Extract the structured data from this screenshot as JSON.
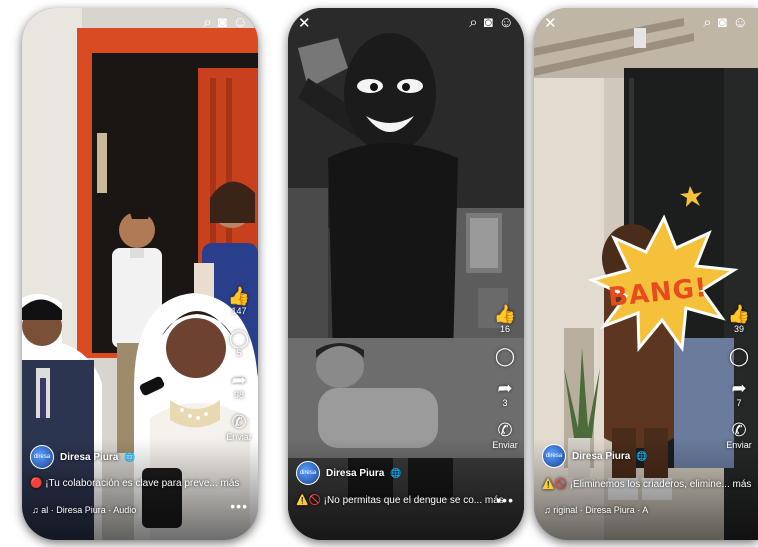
{
  "reels": [
    {
      "author": "Diresa Piura",
      "avatar_text": "diresa",
      "caption": "🔴 ¡Tu colaboración es clave para preve... más",
      "audio": "♫  al · Diresa Piura · Audio",
      "actions": [
        {
          "icon": "like-icon",
          "count": "147"
        },
        {
          "icon": "comment-icon",
          "count": "5"
        },
        {
          "icon": "share-icon",
          "count": "98"
        },
        {
          "icon": "whatsapp-icon",
          "count": "Enviar"
        }
      ]
    },
    {
      "author": "Diresa Piura",
      "avatar_text": "diresa",
      "caption": "⚠️🚫 ¡No permitas que el dengue se co... más",
      "actions": [
        {
          "icon": "like-icon",
          "count": "16"
        },
        {
          "icon": "comment-icon",
          "count": ""
        },
        {
          "icon": "share-icon",
          "count": "3"
        },
        {
          "icon": "whatsapp-icon",
          "count": "Enviar"
        }
      ]
    },
    {
      "author": "Diresa Piura",
      "avatar_text": "diresa",
      "caption": "⚠️🚫 ¡Eliminemos los criaderos, elimine... más",
      "audio": "♫  riginal · Diresa Piura · A",
      "bang_text": "BANG!",
      "actions": [
        {
          "icon": "like-icon",
          "count": "39"
        },
        {
          "icon": "comment-icon",
          "count": ""
        },
        {
          "icon": "share-icon",
          "count": "7"
        },
        {
          "icon": "whatsapp-icon",
          "count": "Enviar"
        }
      ]
    }
  ],
  "icons": {
    "search": "⌕",
    "camera": "◙",
    "profile": "☺",
    "close": "✕",
    "like": "👍",
    "comment": "◯",
    "share": "➦",
    "whatsapp": "✆",
    "more": "•••",
    "globe": "🌐"
  }
}
